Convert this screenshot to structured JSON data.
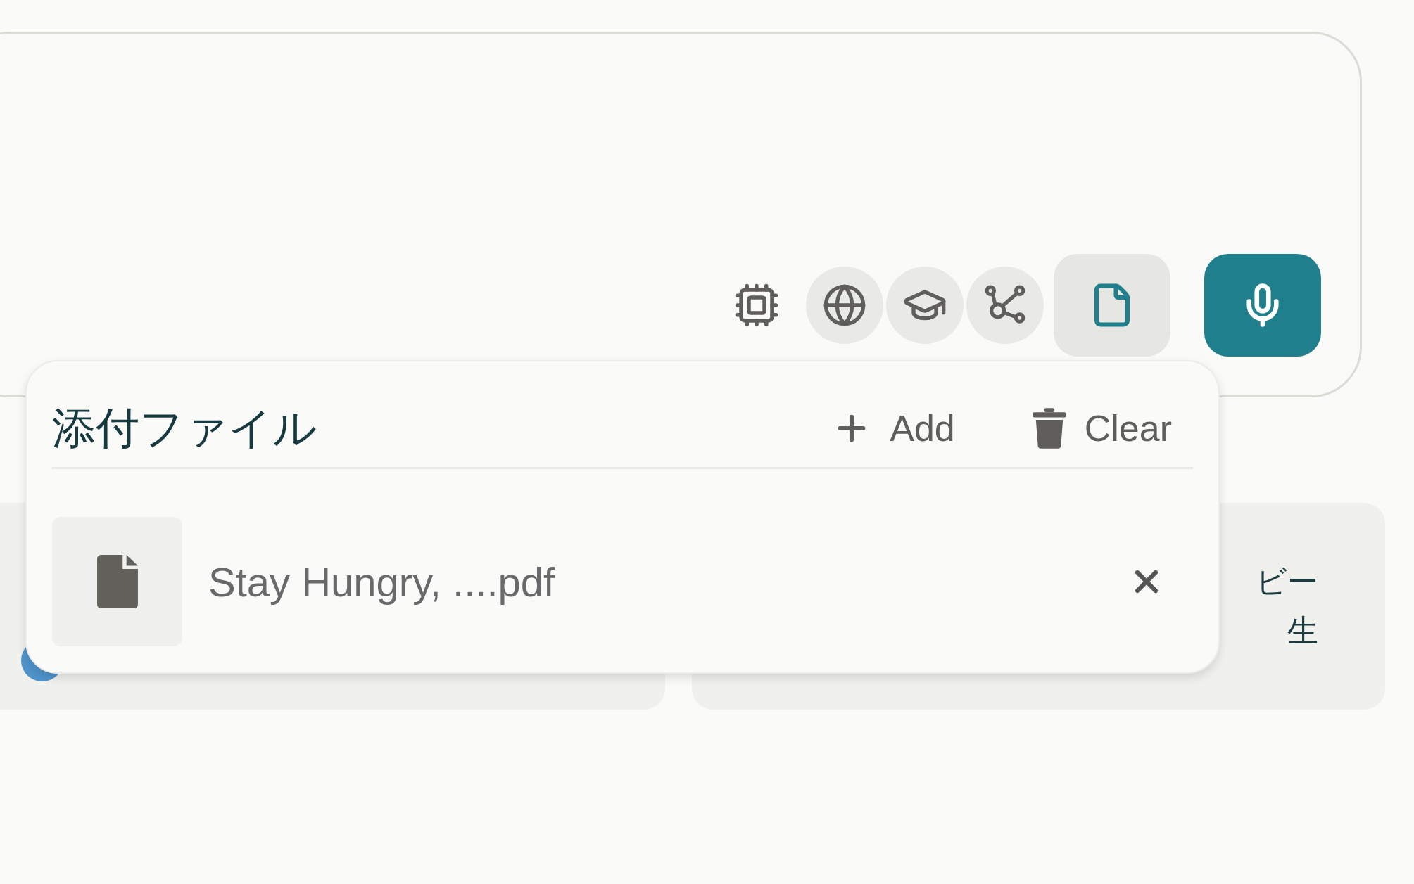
{
  "composer": {
    "tools": [
      {
        "kind": "chip"
      },
      {
        "kind": "globe",
        "on": true
      },
      {
        "kind": "cap",
        "on": true
      },
      {
        "kind": "graph",
        "on": true
      }
    ],
    "attach_button": {
      "selected": true
    },
    "mic_button": {
      "kind": "mic"
    }
  },
  "attachments_popover": {
    "title": "添付ファイル",
    "actions": [
      {
        "kind": "add",
        "label": "Add"
      },
      {
        "kind": "clear",
        "label": "Clear"
      }
    ],
    "files": [
      {
        "name": "Stay Hungry, ....pdf"
      }
    ]
  },
  "suggestion_cards": [
    {
      "lines": [
        "ビー",
        "生"
      ]
    }
  ]
}
